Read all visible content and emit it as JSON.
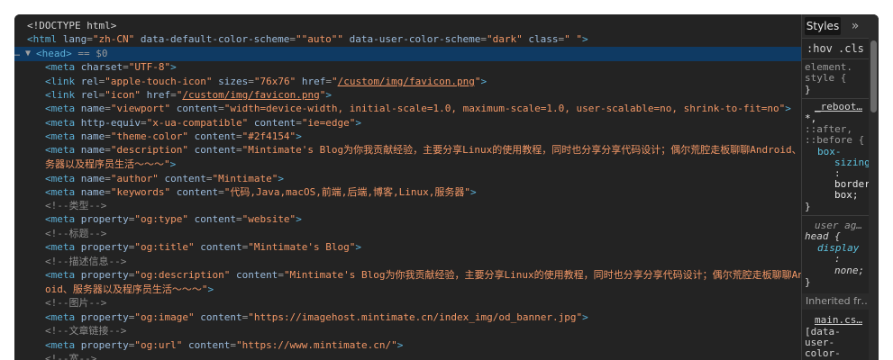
{
  "elements": {
    "selected_marker": "… ▼",
    "selected_eq": "== $0",
    "lines": [
      {
        "indent": "  ",
        "html": "<span class=\"txt\">&lt;!DOCTYPE html&gt;</span>"
      }
    ]
  },
  "code": [
    {
      "i": 0,
      "parts": [
        [
          "txt",
          "<!DOCTYPE html>"
        ]
      ]
    },
    {
      "i": 0,
      "parts": [
        [
          "tag",
          "<html "
        ],
        [
          "attr",
          "lang"
        ],
        [
          "eq",
          "="
        ],
        [
          "val",
          "\"zh-CN\""
        ],
        [
          "attr",
          " data-default-color-scheme"
        ],
        [
          "eq",
          "="
        ],
        [
          "val",
          "\"\"auto\"\""
        ],
        [
          "attr",
          " data-user-color-scheme"
        ],
        [
          "eq",
          "="
        ],
        [
          "val",
          "\"dark\""
        ],
        [
          "attr",
          " class"
        ],
        [
          "eq",
          "="
        ],
        [
          "val",
          "\" \""
        ],
        [
          "tag",
          ">"
        ]
      ]
    },
    {
      "i": 0,
      "sel": true,
      "parts": [
        [
          "tag",
          "<head>"
        ],
        [
          "eq",
          " == $0"
        ]
      ]
    },
    {
      "i": 1,
      "parts": [
        [
          "tag",
          "<meta "
        ],
        [
          "attr",
          "charset"
        ],
        [
          "eq",
          "="
        ],
        [
          "val",
          "\"UTF-8\""
        ],
        [
          "tag",
          ">"
        ]
      ]
    },
    {
      "i": 1,
      "parts": [
        [
          "tag",
          "<link "
        ],
        [
          "attr",
          "rel"
        ],
        [
          "eq",
          "="
        ],
        [
          "val",
          "\"apple-touch-icon\""
        ],
        [
          "attr",
          " sizes"
        ],
        [
          "eq",
          "="
        ],
        [
          "val",
          "\"76x76\""
        ],
        [
          "attr",
          " href"
        ],
        [
          "eq",
          "="
        ],
        [
          "val",
          "\""
        ],
        [
          "link",
          "/custom/img/favicon.png"
        ],
        [
          "val",
          "\""
        ],
        [
          "tag",
          ">"
        ]
      ]
    },
    {
      "i": 1,
      "parts": [
        [
          "tag",
          "<link "
        ],
        [
          "attr",
          "rel"
        ],
        [
          "eq",
          "="
        ],
        [
          "val",
          "\"icon\""
        ],
        [
          "attr",
          " href"
        ],
        [
          "eq",
          "="
        ],
        [
          "val",
          "\""
        ],
        [
          "link",
          "/custom/img/favicon.png"
        ],
        [
          "val",
          "\""
        ],
        [
          "tag",
          ">"
        ]
      ]
    },
    {
      "i": 1,
      "parts": [
        [
          "tag",
          "<meta "
        ],
        [
          "attr",
          "name"
        ],
        [
          "eq",
          "="
        ],
        [
          "val",
          "\"viewport\""
        ],
        [
          "attr",
          " content"
        ],
        [
          "eq",
          "="
        ],
        [
          "val",
          "\"width=device-width, initial-scale=1.0, maximum-scale=1.0, user-scalable=no, shrink-to-fit=no\""
        ],
        [
          "tag",
          ">"
        ]
      ]
    },
    {
      "i": 1,
      "parts": [
        [
          "tag",
          "<meta "
        ],
        [
          "attr",
          "http-equiv"
        ],
        [
          "eq",
          "="
        ],
        [
          "val",
          "\"x-ua-compatible\""
        ],
        [
          "attr",
          " content"
        ],
        [
          "eq",
          "="
        ],
        [
          "val",
          "\"ie=edge\""
        ],
        [
          "tag",
          ">"
        ]
      ]
    },
    {
      "i": 1,
      "parts": [
        [
          "tag",
          "<meta "
        ],
        [
          "attr",
          "name"
        ],
        [
          "eq",
          "="
        ],
        [
          "val",
          "\"theme-color\""
        ],
        [
          "attr",
          " content"
        ],
        [
          "eq",
          "="
        ],
        [
          "val",
          "\"#2f4154\""
        ],
        [
          "tag",
          ">"
        ]
      ]
    },
    {
      "i": 1,
      "parts": [
        [
          "tag",
          "<meta "
        ],
        [
          "attr",
          "name"
        ],
        [
          "eq",
          "="
        ],
        [
          "val",
          "\"description\""
        ],
        [
          "attr",
          " content"
        ],
        [
          "eq",
          "="
        ],
        [
          "val",
          "\"Mintimate's Blog为你我贡献经验，主要分享Linux的使用教程，同时也分享分享代码设计；偶尔荒腔走板聊聊Android、服"
        ]
      ]
    },
    {
      "i": 1,
      "parts": [
        [
          "val",
          "务器以及程序员生活～～～\""
        ],
        [
          "tag",
          ">"
        ]
      ]
    },
    {
      "i": 1,
      "parts": [
        [
          "tag",
          "<meta "
        ],
        [
          "attr",
          "name"
        ],
        [
          "eq",
          "="
        ],
        [
          "val",
          "\"author\""
        ],
        [
          "attr",
          " content"
        ],
        [
          "eq",
          "="
        ],
        [
          "val",
          "\"Mintimate\""
        ],
        [
          "tag",
          ">"
        ]
      ]
    },
    {
      "i": 1,
      "parts": [
        [
          "tag",
          "<meta "
        ],
        [
          "attr",
          "name"
        ],
        [
          "eq",
          "="
        ],
        [
          "val",
          "\"keywords\""
        ],
        [
          "attr",
          " content"
        ],
        [
          "eq",
          "="
        ],
        [
          "val",
          "\"代码,Java,macOS,前端,后端,博客,Linux,服务器\""
        ],
        [
          "tag",
          ">"
        ]
      ]
    },
    {
      "i": 1,
      "parts": [
        [
          "cmt",
          "<!--类型-->"
        ]
      ]
    },
    {
      "i": 1,
      "parts": [
        [
          "tag",
          "<meta "
        ],
        [
          "attr",
          "property"
        ],
        [
          "eq",
          "="
        ],
        [
          "val",
          "\"og:type\""
        ],
        [
          "attr",
          " content"
        ],
        [
          "eq",
          "="
        ],
        [
          "val",
          "\"website\""
        ],
        [
          "tag",
          ">"
        ]
      ]
    },
    {
      "i": 1,
      "parts": [
        [
          "cmt",
          "<!--标题-->"
        ]
      ]
    },
    {
      "i": 1,
      "parts": [
        [
          "tag",
          "<meta "
        ],
        [
          "attr",
          "property"
        ],
        [
          "eq",
          "="
        ],
        [
          "val",
          "\"og:title\""
        ],
        [
          "attr",
          " content"
        ],
        [
          "eq",
          "="
        ],
        [
          "val",
          "\"Mintimate's Blog\""
        ],
        [
          "tag",
          ">"
        ]
      ]
    },
    {
      "i": 1,
      "parts": [
        [
          "cmt",
          "<!--描述信息-->"
        ]
      ]
    },
    {
      "i": 1,
      "parts": [
        [
          "tag",
          "<meta "
        ],
        [
          "attr",
          "property"
        ],
        [
          "eq",
          "="
        ],
        [
          "val",
          "\"og:description\""
        ],
        [
          "attr",
          " content"
        ],
        [
          "eq",
          "="
        ],
        [
          "val",
          "\"Mintimate's Blog为你我贡献经验，主要分享Linux的使用教程，同时也分享分享代码设计；偶尔荒腔走板聊聊Andr"
        ]
      ]
    },
    {
      "i": 1,
      "parts": [
        [
          "val",
          "oid、服务器以及程序员生活～～～\""
        ],
        [
          "tag",
          ">"
        ]
      ]
    },
    {
      "i": 1,
      "parts": [
        [
          "cmt",
          "<!--图片-->"
        ]
      ]
    },
    {
      "i": 1,
      "parts": [
        [
          "tag",
          "<meta "
        ],
        [
          "attr",
          "property"
        ],
        [
          "eq",
          "="
        ],
        [
          "val",
          "\"og:image\""
        ],
        [
          "attr",
          " content"
        ],
        [
          "eq",
          "="
        ],
        [
          "val",
          "\"https://imagehost.mintimate.cn/index_img/od_banner.jpg\""
        ],
        [
          "tag",
          ">"
        ]
      ]
    },
    {
      "i": 1,
      "parts": [
        [
          "cmt",
          "<!--文章链接-->"
        ]
      ]
    },
    {
      "i": 1,
      "parts": [
        [
          "tag",
          "<meta "
        ],
        [
          "attr",
          "property"
        ],
        [
          "eq",
          "="
        ],
        [
          "val",
          "\"og:url\""
        ],
        [
          "attr",
          " content"
        ],
        [
          "eq",
          "="
        ],
        [
          "val",
          "\"https://www.mintimate.cn/\""
        ],
        [
          "tag",
          ">"
        ]
      ]
    },
    {
      "i": 1,
      "parts": [
        [
          "cmt",
          "<!--宽-->"
        ]
      ]
    }
  ],
  "styles": {
    "tab_label": "Styles",
    "more_tabs": "»",
    "hov": ":hov",
    "cls": ".cls",
    "element_style_1": "element.",
    "element_style_2": "style {",
    "element_style_3": "}",
    "reboot_source": "_reboot…",
    "rule1_sel1": "*,",
    "rule1_sel2": "::after,",
    "rule1_sel3": "::before {",
    "rule1_prop_a": "box-",
    "rule1_prop_b": "sizing",
    "rule1_colon": ":",
    "rule1_val_a": "border",
    "rule1_val_b": "box;",
    "rule1_close": "}",
    "ua_source": "user ag…",
    "rule2_sel": "head {",
    "rule2_prop": "display",
    "rule2_colon": ":",
    "rule2_val": "none;",
    "rule2_close": "}",
    "inherited": "Inherited fr…",
    "main_source": "main.cs…",
    "rule3_sel1": "[data-",
    "rule3_sel2": "user-",
    "rule3_sel3": "color-"
  }
}
